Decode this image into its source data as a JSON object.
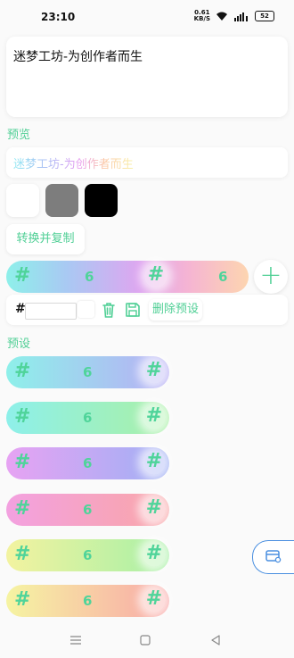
{
  "status_bar": {
    "time": "23:10",
    "net_speed": "0.61",
    "net_unit": "KB/S",
    "battery": "52"
  },
  "input": {
    "text": "迷梦工坊-为创作者而生"
  },
  "preview": {
    "label": "预览",
    "text": "迷梦工坊-为创作者而生"
  },
  "swatches": [
    "#ffffff",
    "#7d7d7d",
    "#000000"
  ],
  "convert_button": "转换并复制",
  "editor": {
    "hash": "#",
    "number_left": "6",
    "number_right": "6",
    "hex_prefix": "#",
    "hex_value": "",
    "delete_preset_label": "删除预设"
  },
  "presets_label": "预设",
  "presets": [
    {
      "hash": "#",
      "number": "6",
      "colors": [
        "#8ef0ea",
        "#b8aef5"
      ]
    },
    {
      "hash": "#",
      "number": "6",
      "colors": [
        "#8ef0ea",
        "#a9f0a6"
      ]
    },
    {
      "hash": "#",
      "number": "6",
      "colors": [
        "#e7a3f3",
        "#9fb0f4"
      ]
    },
    {
      "hash": "#",
      "number": "6",
      "colors": [
        "#f3a1e0",
        "#f9a6a8"
      ]
    },
    {
      "hash": "#",
      "number": "6",
      "colors": [
        "#f3f3a0",
        "#a7f0a6"
      ]
    },
    {
      "hash": "#",
      "number": "6",
      "colors": [
        "#f6f4a2",
        "#f9a8a8"
      ]
    }
  ],
  "accent_color": "#4fcf95"
}
